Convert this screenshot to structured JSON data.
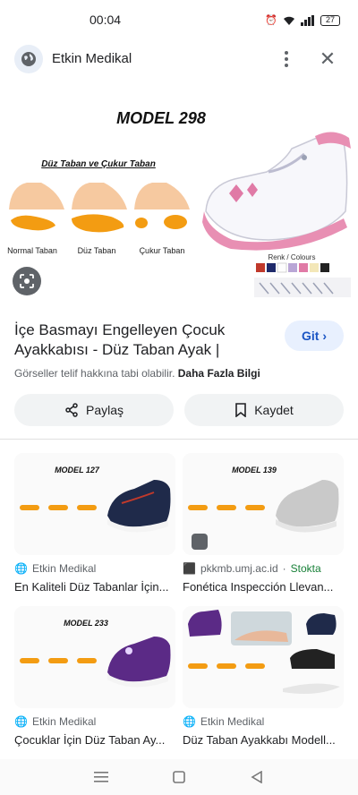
{
  "status_bar": {
    "time": "00:04",
    "battery": "27"
  },
  "header": {
    "site_name": "Etkin Medikal",
    "icons": [
      "globe-icon",
      "more-vert-icon",
      "close-icon"
    ]
  },
  "main_image": {
    "model_title": "MODEL 298",
    "subtitle": "Düz Taban ve Çukur Taban",
    "foot_labels": [
      "Normal Taban",
      "Düz Taban",
      "Çukur Taban"
    ],
    "colours_label": "Renk / Colours"
  },
  "result": {
    "title": "İçe Basmayı Engelleyen Çocuk Ayakkabısı - Düz Taban Ayak |",
    "visit_label": "Git",
    "copyright_text": "Görseller telif hakkına tabi olabilir.",
    "more_info_label": "Daha Fazla Bilgi"
  },
  "actions": {
    "share_label": "Paylaş",
    "save_label": "Kaydet"
  },
  "related": [
    {
      "source": "Etkin Medikal",
      "stock": "",
      "title": "En Kaliteli Düz Tabanlar İçin...",
      "model": "MODEL 127"
    },
    {
      "source": "pkkmb.umj.ac.id",
      "stock": "Stokta",
      "title": "Fonética Inspección Llevan...",
      "model": "MODEL 139"
    },
    {
      "source": "Etkin Medikal",
      "stock": "",
      "title": "Çocuklar İçin Düz Taban Ay...",
      "model": "MODEL 233"
    },
    {
      "source": "Etkin Medikal",
      "stock": "",
      "title": "Düz Taban Ayakkabı Modell...",
      "model": ""
    }
  ],
  "colors": {
    "accent": "#1a55c4",
    "pill_bg": "#e8f0fe",
    "stock_green": "#188038",
    "foot_orange": "#f39c12",
    "shoe_pink": "#e88fb3",
    "shoe_navy": "#1f2a4a",
    "shoe_purple": "#5b2a86"
  }
}
